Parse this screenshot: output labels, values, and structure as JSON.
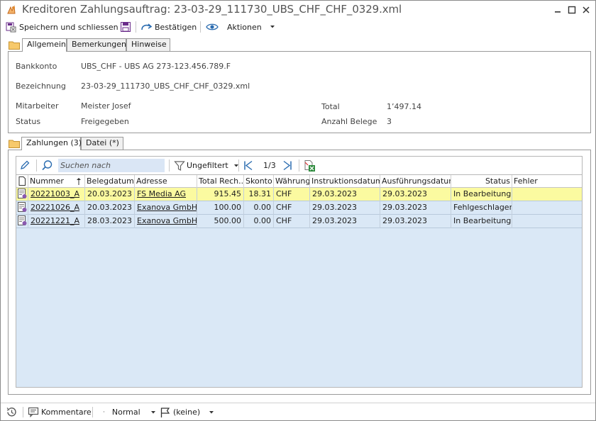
{
  "window": {
    "title": "Kreditoren Zahlungsauftrag: 23-03-29_111730_UBS_CHF_CHF_0329.xml"
  },
  "toolbar": {
    "save_close_label": "Speichern und schliessen",
    "confirm_label": "Bestätigen",
    "actions_label": "Aktionen"
  },
  "tabs_top": [
    {
      "label": "Allgemein"
    },
    {
      "label": "Bemerkungen"
    },
    {
      "label": "Hinweise"
    }
  ],
  "general": {
    "bankkonto_label": "Bankkonto",
    "bankkonto_value": "UBS_CHF  -  UBS AG 273-123.456.789.F",
    "bezeichnung_label": "Bezeichnung",
    "bezeichnung_value": "23-03-29_111730_UBS_CHF_CHF_0329.xml",
    "mitarbeiter_label": "Mitarbeiter",
    "mitarbeiter_value": "Meister Josef",
    "status_label": "Status",
    "status_value": "Freigegeben",
    "total_label": "Total",
    "total_value": "1’497.14",
    "anzahl_label": "Anzahl Belege",
    "anzahl_value": "3"
  },
  "tabs_bottom": [
    {
      "label": "Zahlungen (3)"
    },
    {
      "label": "Datei (*)"
    }
  ],
  "grid_toolbar": {
    "search_placeholder": "Suchen nach",
    "filter_label": "Ungefiltert",
    "pager": "1/3"
  },
  "grid": {
    "columns": [
      "Nummer",
      "Belegdatum",
      "Adresse",
      "Total Rech...",
      "Skonto",
      "Währung",
      "Instruktionsdatum",
      "Ausführungsdatum",
      "Status",
      "Fehler"
    ],
    "rows": [
      {
        "nummer": "20221003_A",
        "belegdatum": "20.03.2023",
        "adresse": "FS Media AG",
        "total": "915.45",
        "skonto": "18.31",
        "waehrung": "CHF",
        "instruktionsdatum": "29.03.2023",
        "ausfuehrungsdatum": "29.03.2023",
        "status": "In Bearbeitung",
        "fehler": ""
      },
      {
        "nummer": "20221026_A",
        "belegdatum": "20.03.2023",
        "adresse": "Exanova GmbH",
        "total": "100.00",
        "skonto": "0.00",
        "waehrung": "CHF",
        "instruktionsdatum": "29.03.2023",
        "ausfuehrungsdatum": "29.03.2023",
        "status": "Fehlgeschlagen",
        "fehler": ""
      },
      {
        "nummer": "20221221_A",
        "belegdatum": "28.03.2023",
        "adresse": "Exanova GmbH",
        "total": "500.00",
        "skonto": "0.00",
        "waehrung": "CHF",
        "instruktionsdatum": "29.03.2023",
        "ausfuehrungsdatum": "29.03.2023",
        "status": "In Bearbeitung",
        "fehler": ""
      }
    ]
  },
  "statusbar": {
    "comments_label": "Kommentare",
    "priority_label": "Normal",
    "flag_label": "(keine)"
  },
  "colors": {
    "selected_row": "#fbfaa0",
    "grid_background": "#dae8f6",
    "accent_blue": "#2b6cb0"
  }
}
